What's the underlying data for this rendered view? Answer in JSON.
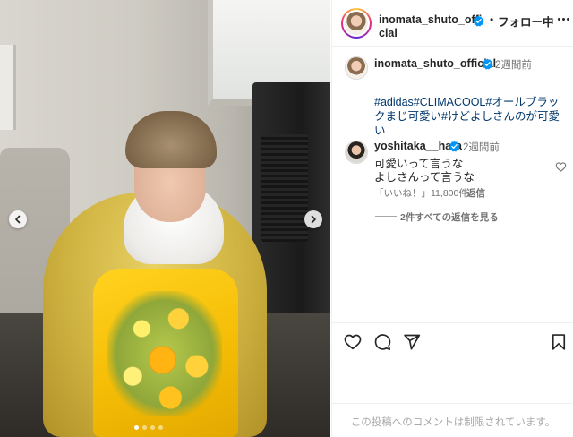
{
  "post": {
    "author": {
      "username_line1": "inomata_shuto_offi",
      "username_line2": "cial",
      "separator": "•",
      "follow_label": "フォロー中"
    },
    "caption": {
      "username": "inomata_shuto_official",
      "time": "2週間前",
      "text": "#adidas#CLIMACOOL#オールブラックまじ可愛い#けどよしさんのが可愛い"
    },
    "comments": [
      {
        "username": "yoshitaka__hara",
        "time": "2週間前",
        "line1": "可愛いって言うな",
        "line2": "よしさんって言うな",
        "likes": "「いいね！」11,800件",
        "reply_label": "返信",
        "view_replies": "2件すべての返信を見る"
      }
    ],
    "comments_disabled": "この投稿へのコメントは制限されています。"
  },
  "carousel": {
    "dot_count": 4,
    "active_index": 0
  },
  "icons": {
    "verified": "verified-badge-icon",
    "like": "heart-icon",
    "comment": "comment-icon",
    "share": "paper-plane-icon",
    "save": "bookmark-icon",
    "prev": "chevron-left-icon",
    "next": "chevron-right-icon"
  },
  "colors": {
    "verified": "#0095f6",
    "hashtag": "#00376b",
    "secondary_text": "#737373",
    "muted_text": "#a8a8a8"
  }
}
